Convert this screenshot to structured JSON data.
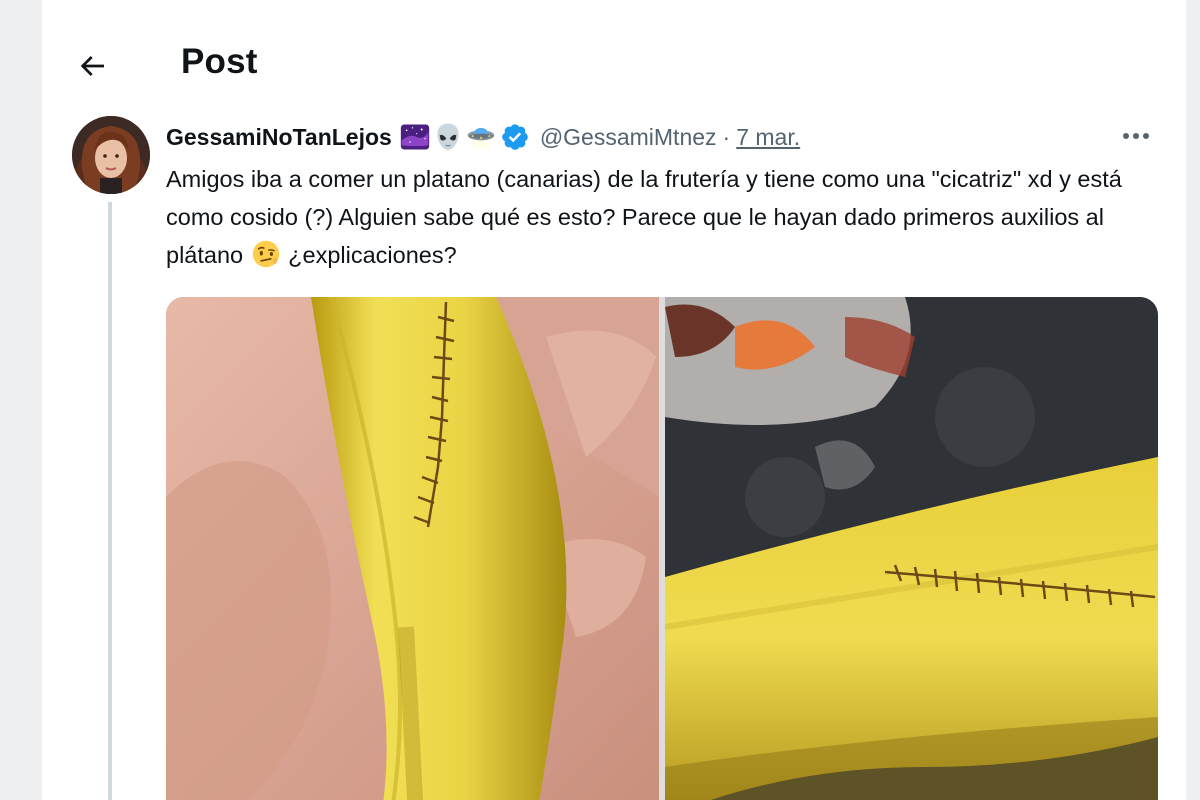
{
  "header": {
    "title": "Post",
    "back_icon": "arrow-left-icon"
  },
  "post": {
    "display_name": "GessamiNoTanLejos",
    "name_emojis": [
      "galaxy-emoji",
      "alien-emoji",
      "ufo-emoji"
    ],
    "verified_icon": "verified-badge-icon",
    "handle": "@GessamiMtnez",
    "separator": "·",
    "date": "7 mar.",
    "more_icon": "more-icon",
    "text_part1": "Amigos iba a comer un platano (canarias) de la frutería y tiene como una \"cicatriz\" xd y está como cosido (?) Alguien sabe qué es esto? Parece que le hayan dado primeros auxilios al plátano ",
    "text_emoji": "raised-eyebrow-face-emoji",
    "text_part2": " ¿explicaciones?"
  },
  "media": {
    "photos": [
      "banana-photo-vertical",
      "banana-photo-horizontal"
    ]
  },
  "colors": {
    "accent": "#1d9bf0",
    "text": "#0f1419",
    "secondary": "#536471",
    "thread_line": "#cfd9de"
  }
}
